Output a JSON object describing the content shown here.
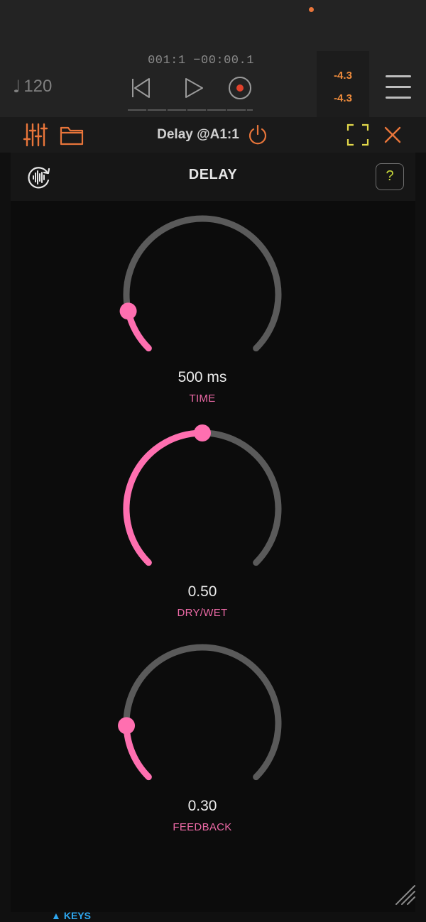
{
  "transport": {
    "tempo_icon": "music-note-icon",
    "tempo": "120",
    "position": "001:1  −00:00.1",
    "meter_left": "-4.3",
    "meter_right": "-4.3"
  },
  "panel": {
    "title": "Delay @A1:1"
  },
  "device": {
    "title": "DELAY",
    "help_label": "?"
  },
  "knobs": [
    {
      "value": "500 ms",
      "label": "TIME",
      "fraction": 0.12
    },
    {
      "value": "0.50",
      "label": "DRY/WET",
      "fraction": 0.5
    },
    {
      "value": "0.30",
      "label": "FEEDBACK",
      "fraction": 0.16
    }
  ],
  "footer": {
    "keys_label": "KEYS"
  },
  "colors": {
    "accent_orange": "#e8753a",
    "knob_pink": "#ff6fb0",
    "knob_track": "#5a5a5a",
    "meter_orange": "#f08c3c",
    "keys_blue": "#2ea7f0",
    "fullscreen_yellow": "#e2d84a"
  }
}
